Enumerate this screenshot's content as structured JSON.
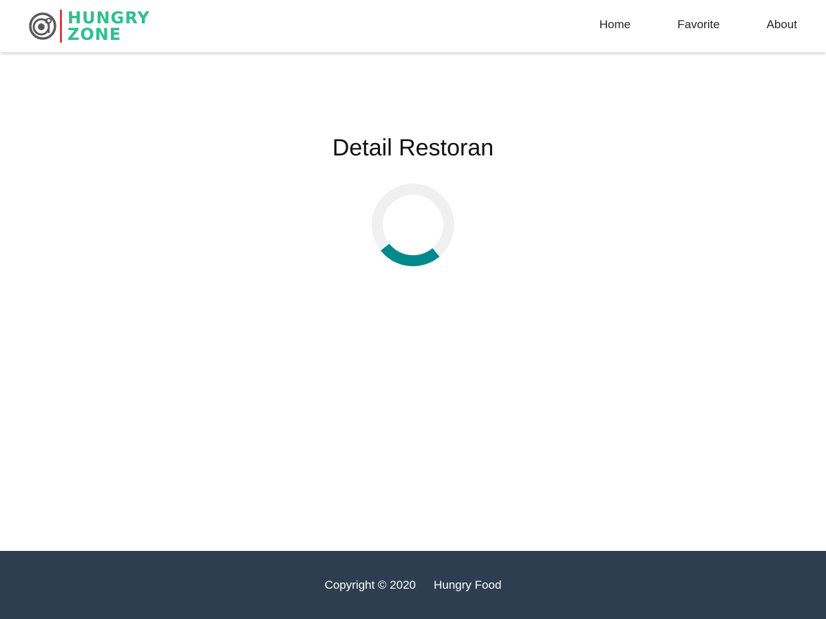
{
  "header": {
    "brand": {
      "line1": "HUNGRY",
      "line2": "ZONE",
      "icon": "plate-cutlery-icon",
      "text_color": "#2fbf8f",
      "divider_color": "#e23b3b"
    },
    "nav": [
      {
        "label": "Home"
      },
      {
        "label": "Favorite"
      },
      {
        "label": "About"
      }
    ]
  },
  "main": {
    "title": "Detail Restoran",
    "loader": {
      "icon": "loading-spinner-icon",
      "track_color": "#f0f0f0",
      "accent_color": "#00898a"
    }
  },
  "footer": {
    "copyright": "Copyright © 2020",
    "owner": "Hungry Food",
    "background": "#2e3e50"
  }
}
